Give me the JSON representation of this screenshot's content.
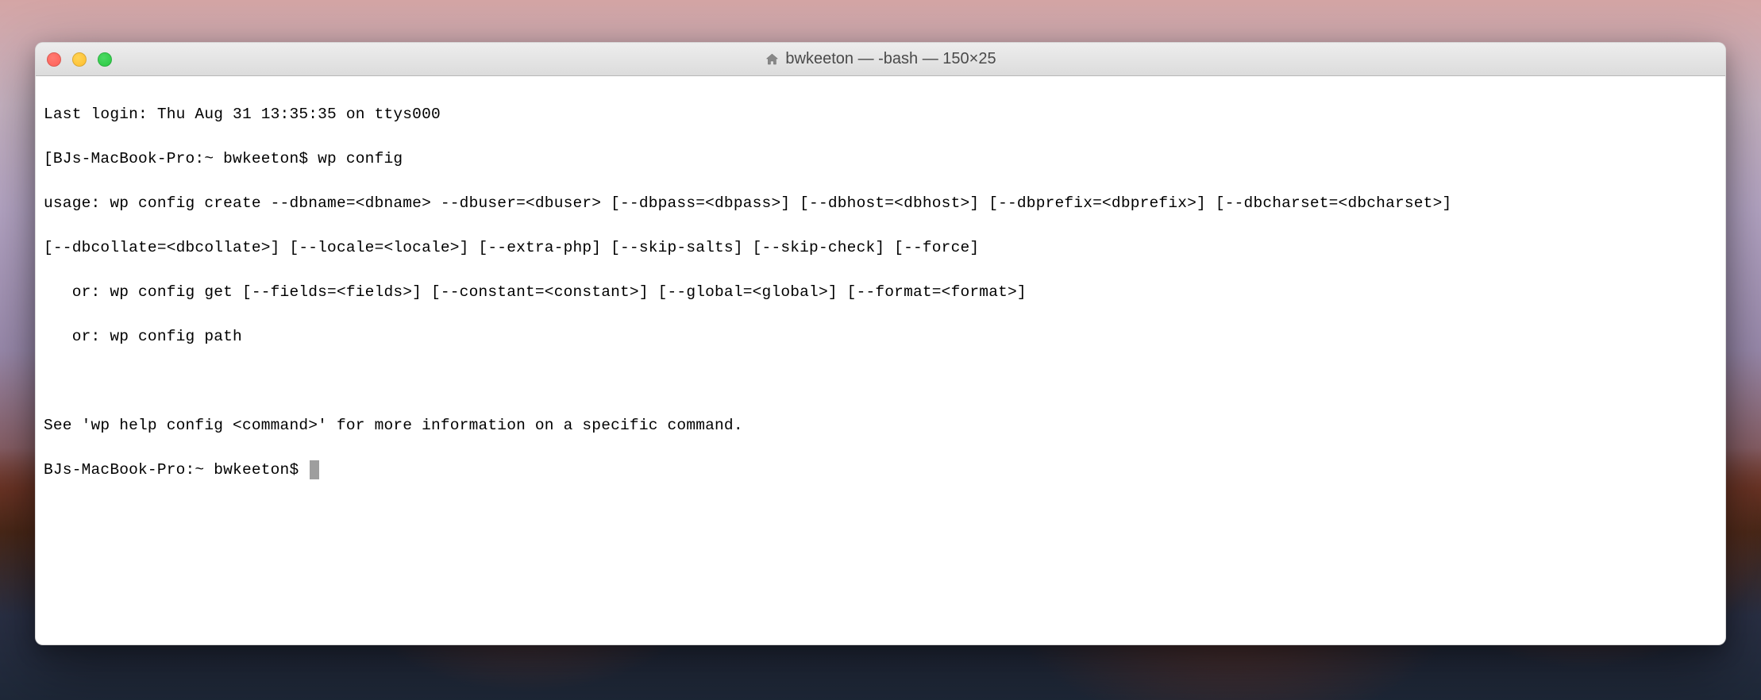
{
  "window": {
    "title": "bwkeeton — -bash — 150×25"
  },
  "terminal": {
    "lines": [
      "Last login: Thu Aug 31 13:35:35 on ttys000",
      "[BJs-MacBook-Pro:~ bwkeeton$ wp config",
      "usage: wp config create --dbname=<dbname> --dbuser=<dbuser> [--dbpass=<dbpass>] [--dbhost=<dbhost>] [--dbprefix=<dbprefix>] [--dbcharset=<dbcharset>]",
      "[--dbcollate=<dbcollate>] [--locale=<locale>] [--extra-php] [--skip-salts] [--skip-check] [--force]",
      "   or: wp config get [--fields=<fields>] [--constant=<constant>] [--global=<global>] [--format=<format>]",
      "   or: wp config path",
      "",
      "See 'wp help config <command>' for more information on a specific command."
    ],
    "prompt": "BJs-MacBook-Pro:~ bwkeeton$ "
  }
}
